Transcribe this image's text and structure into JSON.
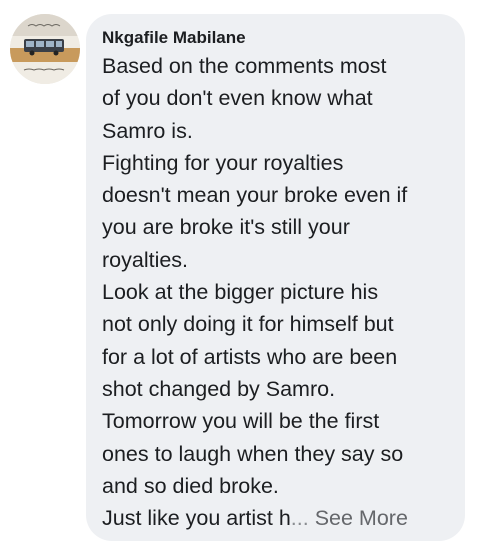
{
  "comment": {
    "author": "Nkgafile Mabilane",
    "lines": [
      "Based on the comments most",
      "of you don't even know what",
      "Samro is.",
      "Fighting for your royalties",
      "doesn't mean your broke even if",
      "you are broke it's still your",
      "royalties.",
      "Look at the bigger picture his",
      "not only doing it for himself but",
      "for a lot of artists who are been",
      "shot changed by Samro.",
      "Tomorrow you will be the first",
      "ones to laugh when they say so",
      "and so died broke."
    ],
    "last_line_text": "Just like you artist h",
    "ellipsis": "...",
    "see_more": "See More"
  },
  "avatar": {
    "icon": "profile-picture-bus-icon",
    "background": "#e8e4dc"
  },
  "colors": {
    "bubble": "#eef0f3",
    "text": "#1c1e21",
    "muted": "#65676b"
  }
}
